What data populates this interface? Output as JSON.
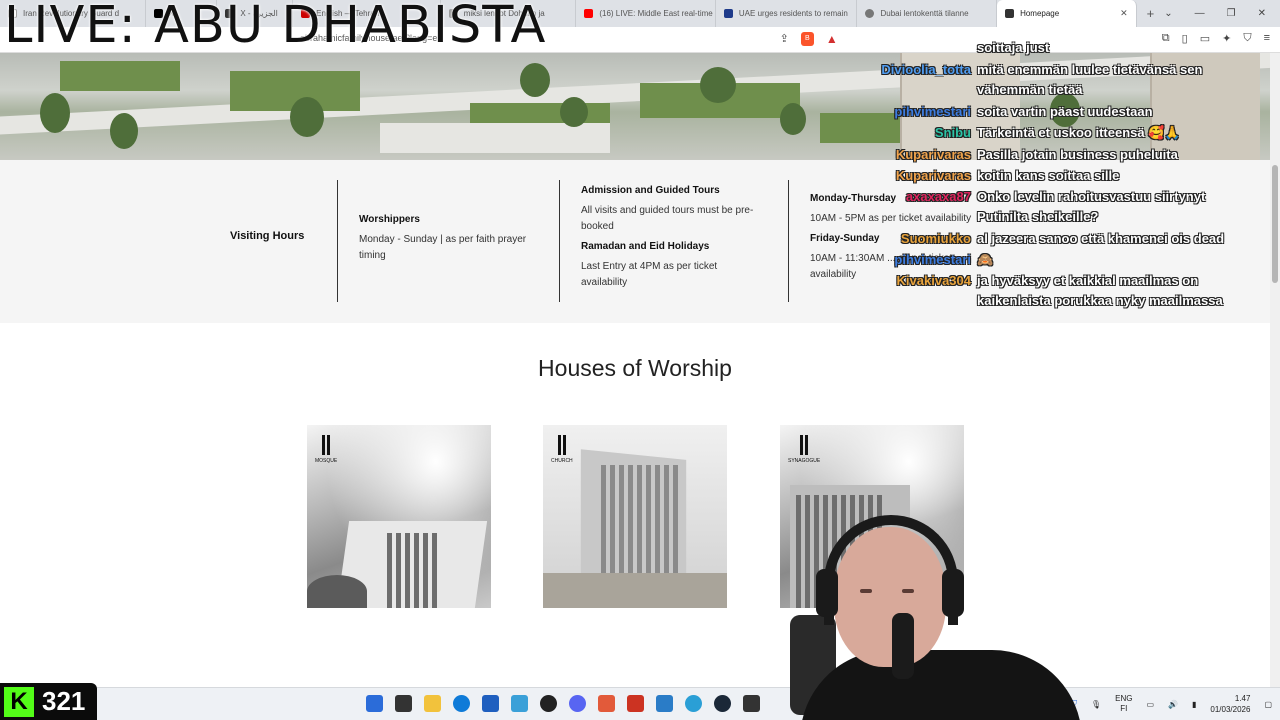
{
  "browser": {
    "tabs": [
      {
        "label": "Iran Revolutionary Guard d",
        "color": "#ffffff"
      },
      {
        "label": "X",
        "color": "#000000"
      },
      {
        "label": "X ‎- الجزيرة",
        "color": "#333333"
      },
      {
        "label": "English — Tehran",
        "color": "#cc0000"
      },
      {
        "label": "miksi lennot Dohaan ja",
        "color": "#999999"
      },
      {
        "label": "(16) LIVE: Middle East real-time",
        "color": "#ff0000"
      },
      {
        "label": "UAE urges residents to remain",
        "color": "#1e3a8a"
      },
      {
        "label": "Dubai lentokenttä tilanne",
        "color": "#777777"
      },
      {
        "label": "Homepage",
        "color": "#333333"
      }
    ],
    "url": "abrahamicfamilyhouse.ae/?lang=en"
  },
  "stream": {
    "title": "LIVE: ABU DHABISTA",
    "follower_count": "321"
  },
  "hours_section": {
    "title": "Visiting Hours",
    "worshippers": {
      "heading": "Worshippers",
      "text": "Monday - Sunday | as per faith prayer timing"
    },
    "admission": {
      "heading": "Admission and Guided Tours",
      "text": "All visits and guided tours must be pre-booked",
      "heading2": "Ramadan and Eid Holidays",
      "text2": "Last Entry at 4PM as per ticket availability"
    },
    "schedule": {
      "heading": "Monday-Thursday",
      "text": "10AM - 5PM as per ticket availability",
      "heading2": "Friday-Sunday",
      "text2": "10AM - 11:30AM ... as per ticket availability"
    }
  },
  "worship": {
    "title": "Houses of Worship",
    "cards": [
      {
        "label": "MOSQUE"
      },
      {
        "label": "CHURCH"
      },
      {
        "label": "SYNAGOGUE"
      }
    ]
  },
  "chat": [
    {
      "user": "",
      "text": "soittaja just",
      "color": "#ffffff"
    },
    {
      "user": "Divioolia_totta",
      "text": "mitä enemmän luulee tietävänsä sen",
      "color": "#4f9cf0"
    },
    {
      "user": "",
      "text": "vähemmän tietää",
      "color": "#ffffff"
    },
    {
      "user": "pihvimestari",
      "text": "soita vartin päast uudestaan",
      "color": "#3d7de0"
    },
    {
      "user": "Snibu",
      "text": "Tärkeintä et uskoo itteensä 🥰🙏",
      "color": "#2ec4a6"
    },
    {
      "user": "Kuparivaras",
      "text": "Pasilla jotain business puheluita",
      "color": "#f0a34c"
    },
    {
      "user": "Kuparivaras",
      "text": "koitin kans soittaa sille",
      "color": "#f0a34c"
    },
    {
      "user": "axaxaxa87",
      "text": "Onko levelin rahoitusvastuu siirtynyt",
      "color": "#e0245e"
    },
    {
      "user": "",
      "text": "Putinilta sheikeille?",
      "color": "#ffffff"
    },
    {
      "user": "Suomiukko",
      "text": "al jazeera sanoo että khamenei ois dead",
      "color": "#e8a33c"
    },
    {
      "user": "pihvimestari",
      "text": "🙈",
      "color": "#3d7de0"
    },
    {
      "user": "Kivakiva304",
      "text": "ja hyväksyy et kaikkial maailmas on",
      "color": "#e8a33c"
    },
    {
      "user": "",
      "text": "kaikenlaista porukkaa nyky maailmassa",
      "color": "#ffffff"
    }
  ],
  "taskbar": {
    "lang_line1": "ENG",
    "lang_line2": "FI",
    "time": "1.47",
    "date": "01/03/2026",
    "app_colors": [
      "#2b6cd9",
      "#333333",
      "#f2c23c",
      "#0f7bd8",
      "#1f5fbf",
      "#3aa0d8",
      "#222222",
      "#5865f2",
      "#e25a3a",
      "#cc3322",
      "#2a7cc7",
      "#2a9fd6",
      "#1b2838",
      "#333333"
    ]
  }
}
